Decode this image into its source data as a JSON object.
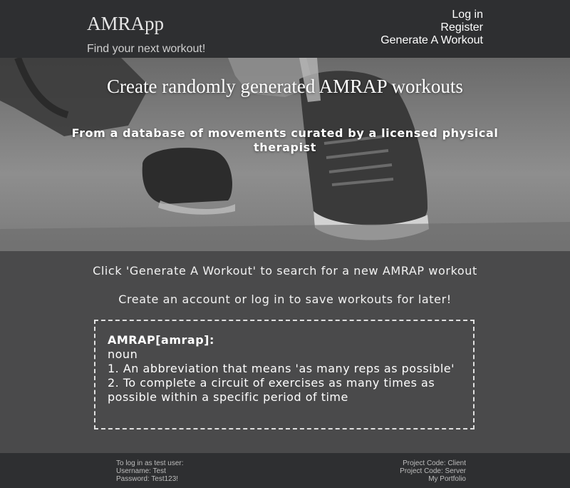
{
  "header": {
    "brand": "AMRApp",
    "tagline": "Find your next workout!",
    "nav": {
      "login": "Log in",
      "register": "Register",
      "generate": "Generate A Workout"
    }
  },
  "hero": {
    "title": "Create randomly generated AMRAP workouts",
    "subtitle": "From a database of movements curated by a licensed physical therapist"
  },
  "main": {
    "instruction": "Click 'Generate A Workout' to search for a new AMRAP workout",
    "account_note": "Create an account or log in to save workouts for later!",
    "definition": {
      "term": "AMRAP[amrap]:",
      "part_of_speech": "noun",
      "sense_1": "1. An abbreviation that means 'as many reps as possible'",
      "sense_2": "2. To complete a circuit of exercises as many times as possible within a specific period of time"
    }
  },
  "footer": {
    "test_user_heading": "To log in as test user:",
    "username": "Username: Test",
    "password": "Password: Test123!",
    "links": {
      "client": "Project Code: Client",
      "server": "Project Code: Server",
      "portfolio": "My Portfolio"
    }
  },
  "colors": {
    "header_bg": "#2e2f31",
    "page_bg": "#4a4a4b",
    "text": "#ffffff"
  }
}
